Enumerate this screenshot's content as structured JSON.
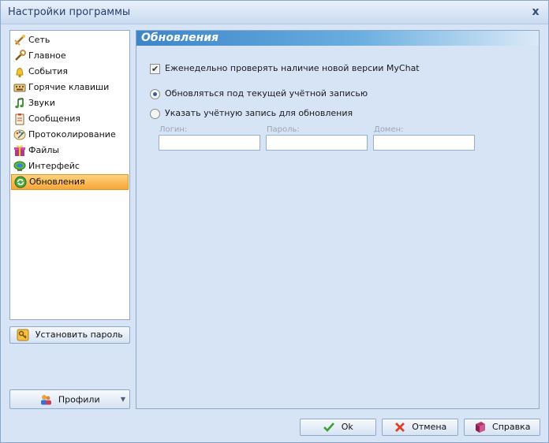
{
  "window": {
    "title": "Настройки программы",
    "close_glyph": "x"
  },
  "sidebar": {
    "items": [
      {
        "label": "Сеть",
        "icon": "network-icon"
      },
      {
        "label": "Главное",
        "icon": "wrench-icon"
      },
      {
        "label": "События",
        "icon": "bell-icon"
      },
      {
        "label": "Горячие клавиши",
        "icon": "keyboard-icon"
      },
      {
        "label": "Звуки",
        "icon": "music-note-icon"
      },
      {
        "label": "Сообщения",
        "icon": "clipboard-icon"
      },
      {
        "label": "Протоколирование",
        "icon": "palette-icon"
      },
      {
        "label": "Файлы",
        "icon": "gift-icon"
      },
      {
        "label": "Интерфейс",
        "icon": "monitor-icon"
      },
      {
        "label": "Обновления",
        "icon": "refresh-icon"
      }
    ],
    "selected_index": 9,
    "set_password_label": "Установить пароль",
    "profiles_label": "Профили"
  },
  "content": {
    "section_title": "Обновления",
    "weekly_check_label": "Еженедельно проверять наличие новой версии MyChat",
    "weekly_check_checked": true,
    "radio_current_label": "Обновляться под текущей учётной записью",
    "radio_other_label": "Указать учётную запись для обновления",
    "radio_selected": "current",
    "fields": {
      "login_label": "Логин:",
      "password_label": "Пароль:",
      "domain_label": "Домен:",
      "login_value": "",
      "password_value": "",
      "domain_value": ""
    }
  },
  "footer": {
    "ok_label": "Ok",
    "cancel_label": "Отмена",
    "help_label": "Справка"
  },
  "colors": {
    "accent_header": "#3c85c8",
    "selected_item": "#f7a637",
    "window_bg": "#d6e4f5"
  }
}
